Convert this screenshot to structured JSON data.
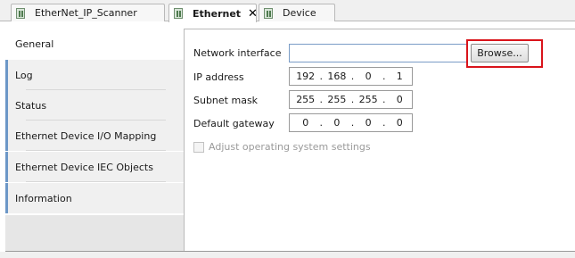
{
  "tabs": [
    {
      "label": "EtherNet_IP_Scanner",
      "active": false
    },
    {
      "label": "Ethernet",
      "active": true,
      "closable": true
    },
    {
      "label": "Device",
      "active": false
    }
  ],
  "close_glyph": "✕",
  "side_tabs": [
    {
      "label": "General",
      "active": true
    },
    {
      "label": "Log",
      "active": false
    },
    {
      "label": "Status",
      "active": false
    },
    {
      "label": "Ethernet Device I/O Mapping",
      "active": false
    },
    {
      "label": "Ethernet Device IEC Objects",
      "active": false
    },
    {
      "label": "Information",
      "active": false
    }
  ],
  "form": {
    "network_interface_label": "Network interface",
    "network_interface_value": "",
    "browse_label": "Browse...",
    "ip_label": "IP address",
    "ip_octets": [
      "192",
      "168",
      "0",
      "1"
    ],
    "subnet_label": "Subnet mask",
    "subnet_octets": [
      "255",
      "255",
      "255",
      "0"
    ],
    "gateway_label": "Default gateway",
    "gateway_octets": [
      "0",
      "0",
      "0",
      "0"
    ],
    "adjust_label": "Adjust operating system settings",
    "adjust_checked": false
  },
  "colors": {
    "highlight": "#d9141b",
    "side_tab_accent": "#6c97c7"
  },
  "icons": {
    "tab_icon": "device-icon",
    "close": "close-icon"
  }
}
